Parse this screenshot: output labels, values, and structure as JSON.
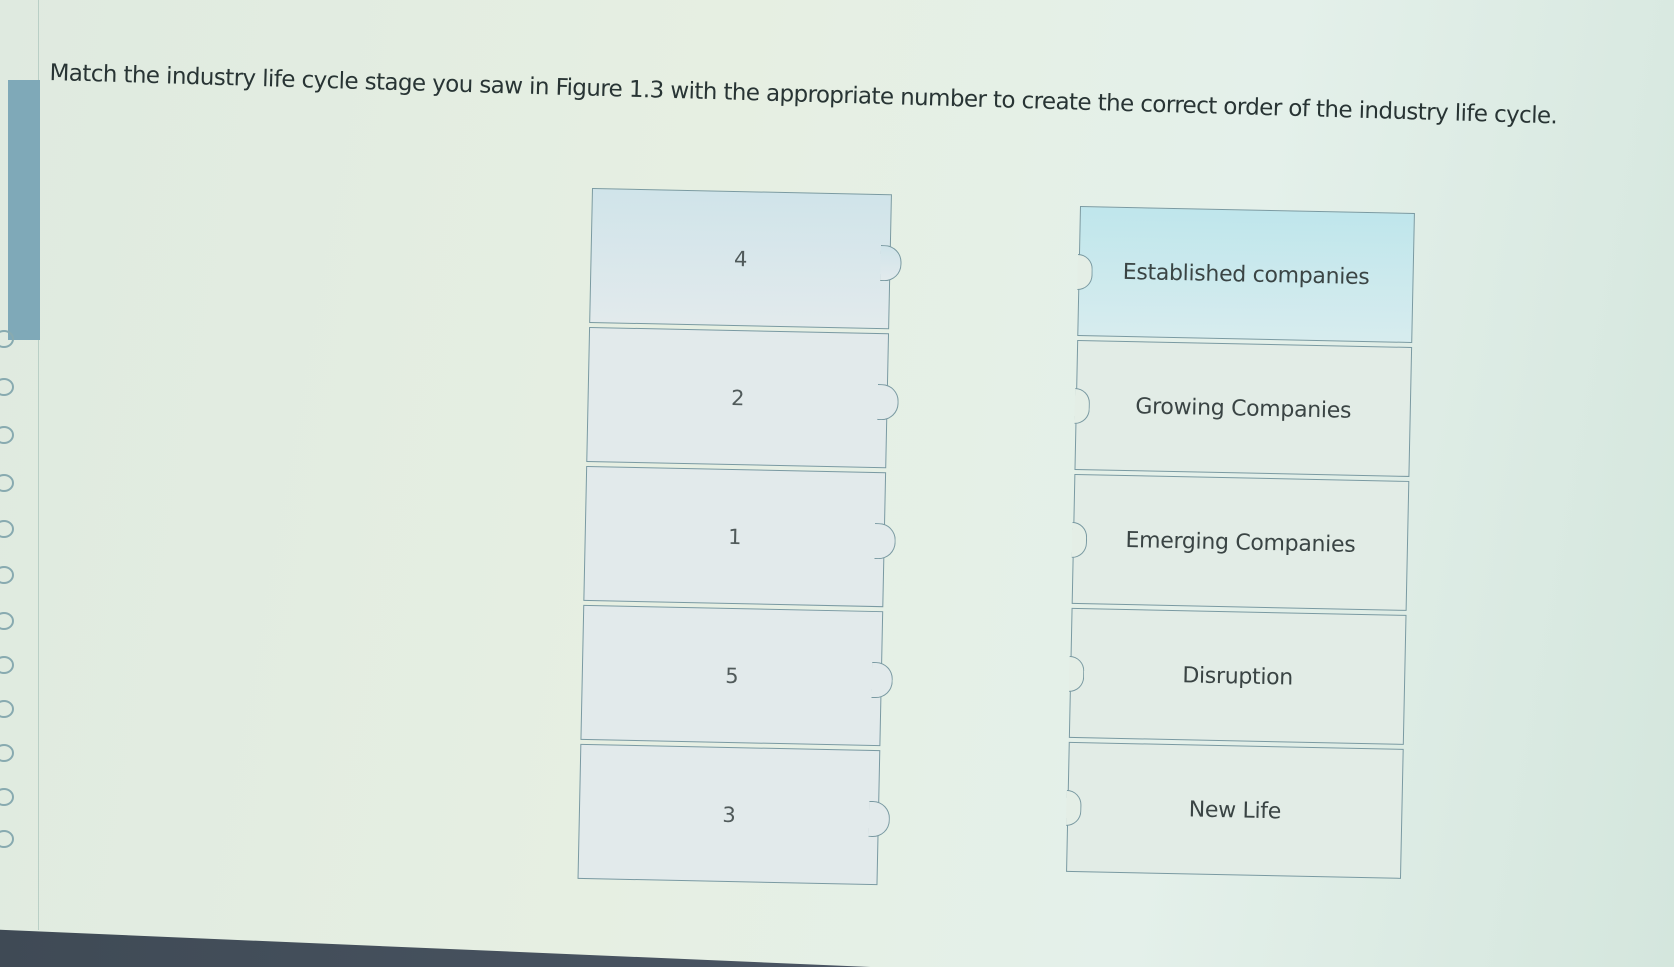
{
  "question": {
    "prompt": "Match the industry life cycle stage you saw in Figure 1.3 with the appropriate number to create the correct order of the industry life cycle."
  },
  "numbers": [
    {
      "label": "4"
    },
    {
      "label": "2"
    },
    {
      "label": "1"
    },
    {
      "label": "5"
    },
    {
      "label": "3"
    }
  ],
  "stages": [
    {
      "label": "Established companies"
    },
    {
      "label": "Growing Companies"
    },
    {
      "label": "Emerging Companies"
    },
    {
      "label": "Disruption"
    },
    {
      "label": "New Life"
    }
  ],
  "colors": {
    "accent": "#7fa9b8",
    "tile_border": "#7a9aa2",
    "active_tile": "#bfe6ec"
  }
}
